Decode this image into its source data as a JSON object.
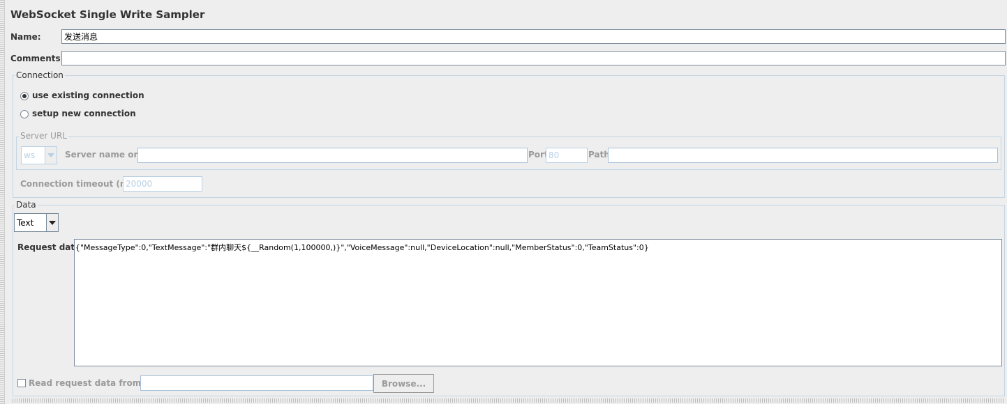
{
  "title": "WebSocket Single Write Sampler",
  "name": {
    "label": "Name:",
    "value": "发送消息"
  },
  "comments": {
    "label": "Comments:",
    "value": ""
  },
  "connection": {
    "title": "Connection",
    "options": [
      {
        "label": "use existing connection",
        "checked": true
      },
      {
        "label": "setup new connection",
        "checked": false
      }
    ],
    "server_url": {
      "title": "Server URL",
      "protocol": "ws",
      "server_label": "Server name or IP:",
      "server_value": "",
      "port_label": "Port:",
      "port_placeholder": "80",
      "path_label": "Path:",
      "path_value": ""
    },
    "timeout_label": "Connection timeout (ms):",
    "timeout_placeholder": "20000"
  },
  "data": {
    "title": "Data",
    "type_selected": "Text",
    "request_label": "Request data:",
    "request_value": "{\"MessageType\":0,\"TextMessage\":\"群内聊天${__Random(1,100000,)}\",\"VoiceMessage\":null,\"DeviceLocation\":null,\"MemberStatus\":0,\"TeamStatus\":0}",
    "read_from_file_label": "Read request data from file:",
    "file_value": "",
    "browse_label": "Browse..."
  }
}
